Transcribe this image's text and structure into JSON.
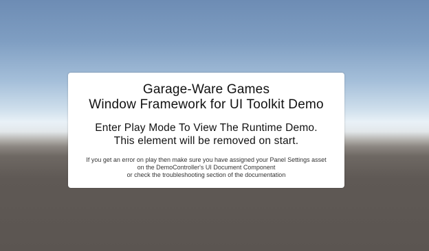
{
  "dialog": {
    "title_line1": "Garage-Ware Games",
    "title_line2": "Window Framework for UI Toolkit Demo",
    "subtitle_line1": "Enter Play Mode To View The Runtime Demo.",
    "subtitle_line2": "This element will be removed on start.",
    "note_line1": "If you get an error on play then make sure you have assigned your Panel Settings asset",
    "note_line2": "on the DemoController's UI Document Component",
    "note_line3": "or check the troubleshooting section of the documentation"
  }
}
